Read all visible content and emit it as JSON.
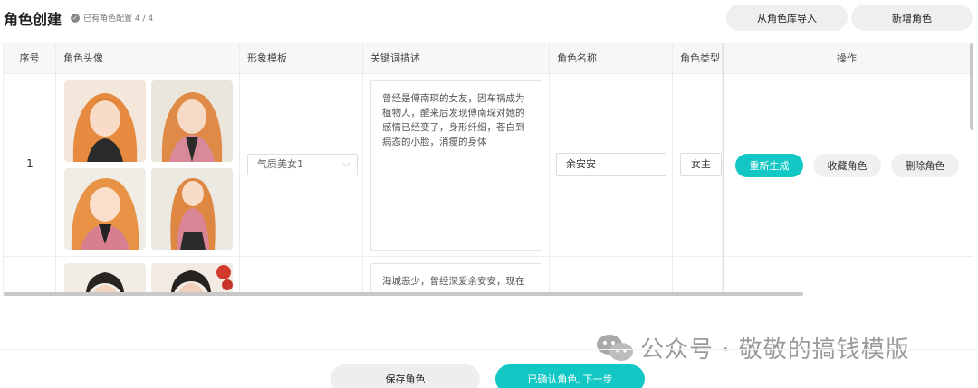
{
  "header": {
    "title": "角色创建",
    "badge_text": "已有角色配置 4 / 4",
    "import_button": "从角色库导入",
    "add_button": "新增角色"
  },
  "table": {
    "columns": [
      "序号",
      "角色头像",
      "形象模板",
      "关键词描述",
      "角色名称",
      "角色类型",
      "操作"
    ],
    "rows": [
      {
        "index": "1",
        "template": "气质美女1",
        "description": "曾经是傅南琛的女友，因车祸成为植物人，醒来后发现傅南琛对她的感情已经变了，身形纤细，苍白到病态的小脸，消瘦的身体",
        "name": "余安安",
        "type": "女主",
        "actions": {
          "regenerate": "重新生成",
          "favorite": "收藏角色",
          "delete": "删除角色"
        }
      },
      {
        "index": "",
        "description": "海城恶少，曾经深爱余安安，现在"
      }
    ]
  },
  "footer": {
    "save_button": "保存角色",
    "confirm_button": "已确认角色, 下一步"
  },
  "watermark": {
    "text": "公众号 · 敬敬的搞钱模版"
  },
  "colors": {
    "accent": "#12c7c4",
    "button_gray": "#efefef",
    "header_bg": "#f7f7f7"
  }
}
